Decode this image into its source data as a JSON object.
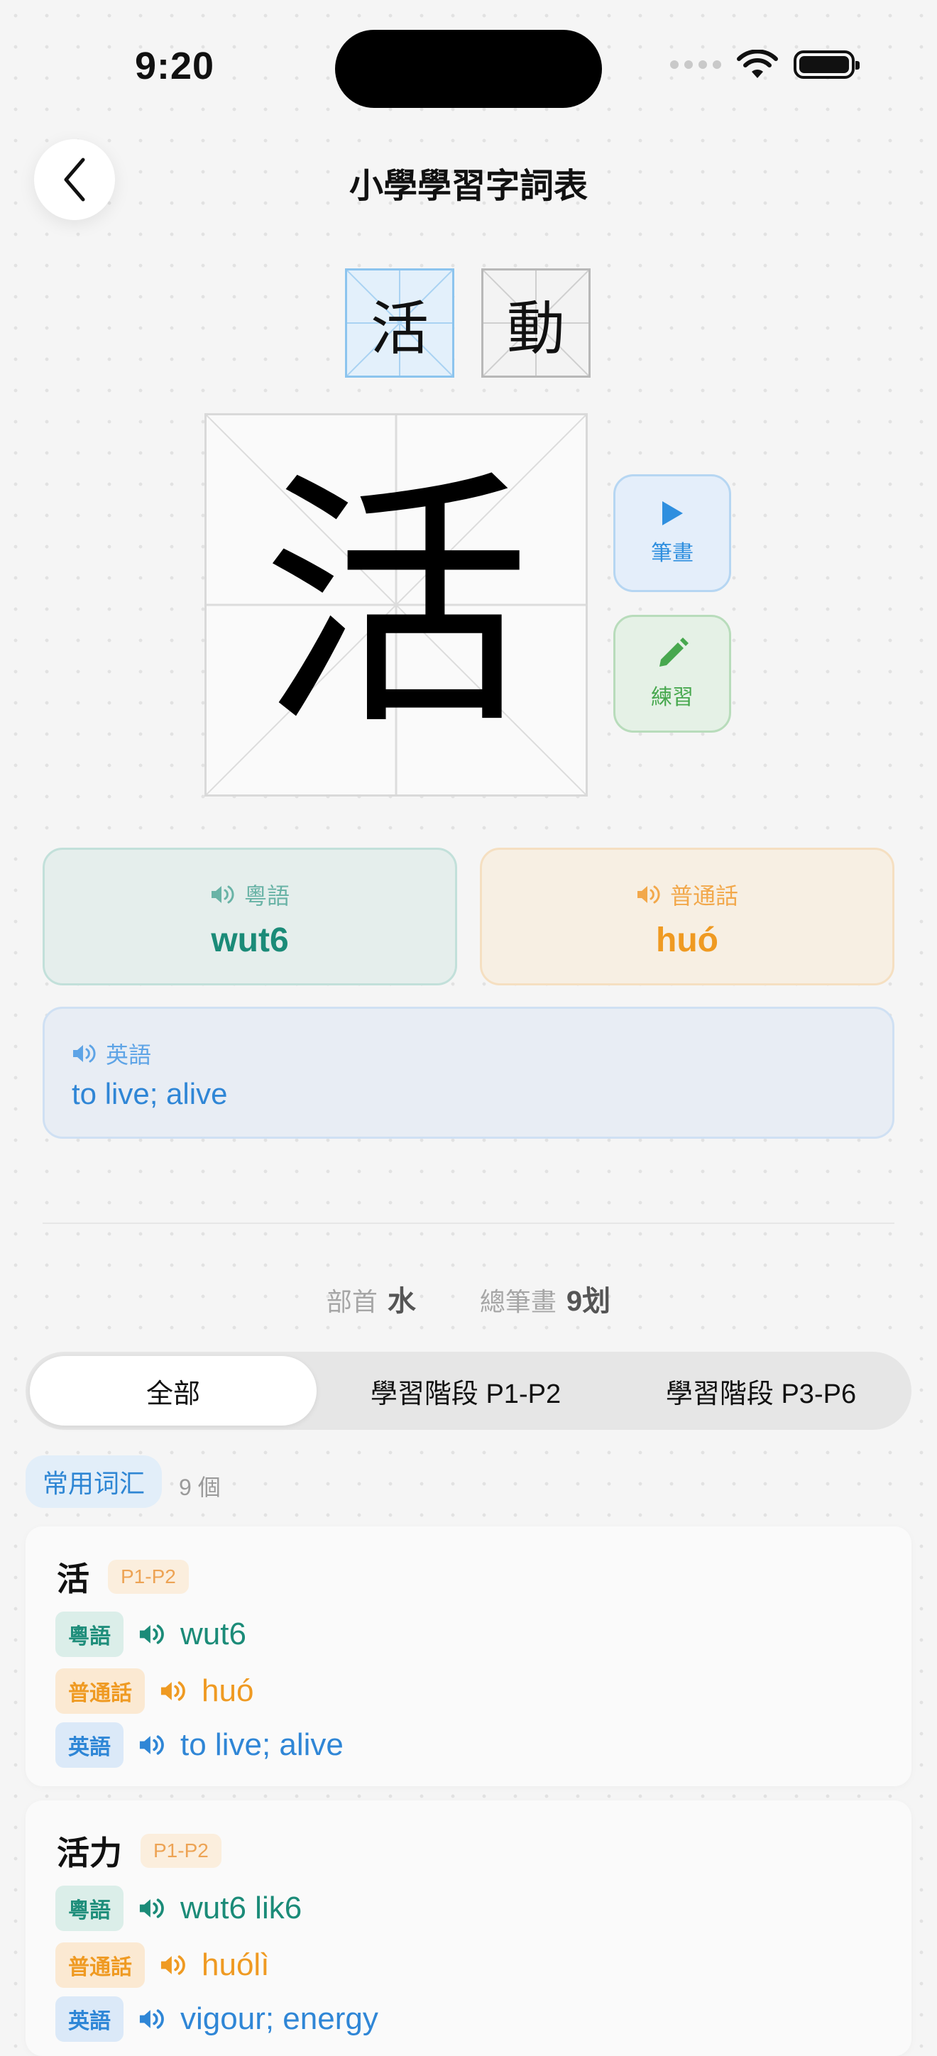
{
  "status": {
    "time": "9:20"
  },
  "nav": {
    "title": "小學學習字詞表"
  },
  "char_tabs": [
    {
      "char": "活",
      "selected": true
    },
    {
      "char": "動",
      "selected": false
    }
  ],
  "main_char": "活",
  "actions": {
    "stroke_label": "筆畫",
    "practice_label": "練習"
  },
  "pron": {
    "cantonese_label": "粵語",
    "cantonese_value": "wut6",
    "mandarin_label": "普通話",
    "mandarin_value": "huó",
    "english_label": "英語",
    "english_value": "to live; alive"
  },
  "meta": {
    "radical_label": "部首",
    "radical_value": "水",
    "strokes_label": "總筆畫",
    "strokes_value": "9划"
  },
  "segments": [
    "全部",
    "學習階段 P1-P2",
    "學習階段 P3-P6"
  ],
  "vocab": {
    "badge": "常用词汇",
    "count": "9 個"
  },
  "words": [
    {
      "word": "活",
      "level": "P1-P2",
      "cantonese_tag": "粵語",
      "cantonese": "wut6",
      "mandarin_tag": "普通話",
      "mandarin": "huó",
      "english_tag": "英語",
      "english": "to live; alive"
    },
    {
      "word": "活力",
      "level": "P1-P2",
      "cantonese_tag": "粵語",
      "cantonese": "wut6 lik6",
      "mandarin_tag": "普通話",
      "mandarin": "huólì",
      "english_tag": "英語",
      "english": "vigour; energy"
    }
  ],
  "colors": {
    "cantonese": "#1b8b78",
    "mandarin": "#ef9a22",
    "english": "#2f86d6",
    "stroke_blue": "#2f8fdf",
    "practice_green": "#47a84e"
  }
}
